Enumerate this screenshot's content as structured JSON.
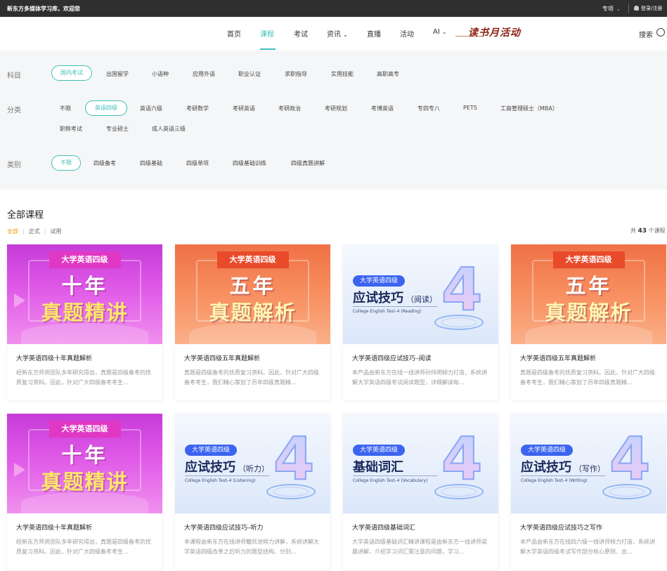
{
  "topbar": {
    "welcome": "新东方多媒体学习库，欢迎您",
    "special": "专项",
    "login": "登录/注册"
  },
  "nav": {
    "items": [
      "首页",
      "课程",
      "考试",
      "资讯",
      "直播",
      "活动",
      "AI"
    ],
    "active": "课程",
    "banner_text": "读书月活动",
    "search_label": "搜索"
  },
  "filters": {
    "subject": {
      "label": "科目",
      "options": [
        "国内考试",
        "出国留学",
        "小语种",
        "应用外语",
        "职业认证",
        "求职指导",
        "实用技能",
        "高职高专"
      ],
      "selected": "国内考试"
    },
    "category": {
      "label": "分类",
      "options": [
        "不限",
        "英语四级",
        "英语六级",
        "考研数学",
        "考研英语",
        "考研政治",
        "考研规划",
        "考博英语",
        "专四专八",
        "PETS",
        "工商管理硕士（MBA）",
        "职称考试",
        "专业硕士",
        "成人英语三级"
      ],
      "selected": "英语四级"
    },
    "type": {
      "label": "类别",
      "options": [
        "不限",
        "四级备考",
        "四级基础",
        "四级单项",
        "四级基础训练",
        "四级真题讲解"
      ],
      "selected": "不限"
    }
  },
  "courses_section": {
    "title": "全部课程",
    "tabs": [
      "全部",
      "正式",
      "试用"
    ],
    "active_tab": "全部",
    "count_prefix": "共",
    "count": "43",
    "count_suffix": "个课程"
  },
  "courses": [
    {
      "title": "大学英语四级十年真题解析",
      "desc": "经新东方师资团队多年研究得出，真题是四级备考的优质复习资料。因此，针对广大四级备考考生…",
      "thumb": {
        "style": "pink",
        "ribbon": "大学英语四级",
        "line1": "十年",
        "line2": "真题精讲"
      }
    },
    {
      "title": "大学英语四级五年真题解析",
      "desc": "真题是四级备考的优质复习资料。因此，针对广大四级备考考生，我们精心策划了历年四级真题精…",
      "thumb": {
        "style": "orange",
        "ribbon": "大学英语四级",
        "line1": "五年",
        "line2": "真题解析"
      }
    },
    {
      "title": "大学英语四级应试技巧–阅读",
      "desc": "本产品由新东方在线一线讲师孙炜明倾力打造，系统讲解大学英语四级考试阅读题型，详细解读每…",
      "thumb": {
        "style": "blue",
        "pill": "大学英语四级",
        "heading": "应试技巧",
        "heading_small": "（阅读）",
        "sub": "College English Test–4 (Reading)"
      }
    },
    {
      "title": "大学英语四级五年真题解析",
      "desc": "真题是四级备考的优质复习资料。因此，针对广大四级备考考生，我们精心策划了历年四级真题精…",
      "thumb": {
        "style": "orange",
        "ribbon": "大学英语四级",
        "line1": "五年",
        "line2": "真题解析"
      }
    },
    {
      "title": "大学英语四级十年真题解析",
      "desc": "经新东方师资团队多年研究得出，真题是四级备考的优质复习资料。因此，针对广大四级备考考生…",
      "thumb": {
        "style": "pink",
        "ribbon": "大学英语四级",
        "line1": "十年",
        "line2": "真题精讲"
      }
    },
    {
      "title": "大学英语四级应试技巧–听力",
      "desc": "本课程由新东方在线讲师戴欣池倾力讲解，系统讲解大学英语四级改革之后听力的题型结构、分别…",
      "thumb": {
        "style": "blue",
        "pill": "大学英语四级",
        "heading": "应试技巧",
        "heading_small": "（听力）",
        "sub": "College English Test–4 (Listening)"
      }
    },
    {
      "title": "大学英语四级基础词汇",
      "desc": "大学英语四级基础词汇精讲课程是由新东方一线讲师梁晨讲解，介绍学习词汇需注意的问题，学习…",
      "thumb": {
        "style": "blue",
        "pill": "大学英语四级",
        "heading": "基础词汇",
        "heading_small": "",
        "sub": "College English Test–4 (Vocabulary)"
      }
    },
    {
      "title": "大学英语四级应试技巧之写作",
      "desc": "本产品由新东方在线四六级一线讲师倾力打造，系统讲解大学英语四级考试写作部分核心原则、出…",
      "thumb": {
        "style": "blue",
        "pill": "大学英语四级",
        "heading": "应试技巧",
        "heading_small": "（写作）",
        "sub": "College English Test–4 (Writing)"
      }
    }
  ],
  "colors": {
    "accent": "#3fbfb9",
    "tab_active": "#f39800",
    "topbar": "#2f2f2f",
    "filter_bg": "#f5f6f7"
  }
}
